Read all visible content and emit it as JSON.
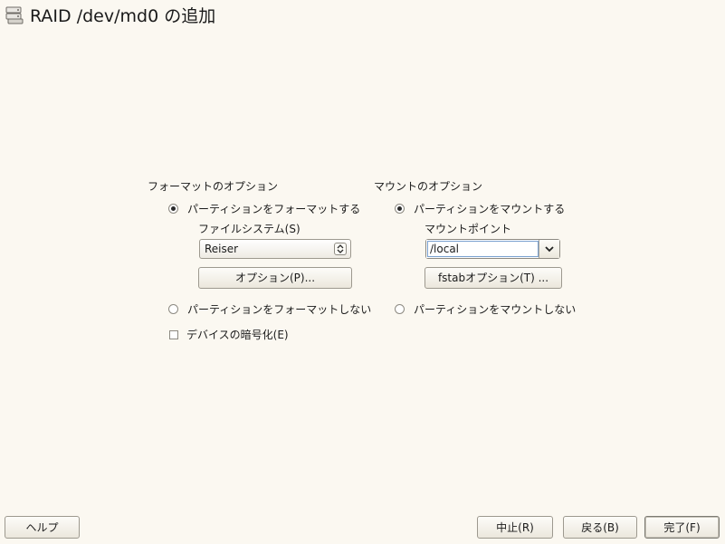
{
  "window": {
    "title": "RAID /dev/md0 の追加"
  },
  "format_options": {
    "heading": "フォーマットのオプション",
    "format_radio_label": "パーティションをフォーマットする",
    "format_selected": true,
    "filesystem_label": "ファイルシステム(S)",
    "filesystem_value": "Reiser",
    "options_button": "オプション(P)...",
    "no_format_radio_label": "パーティションをフォーマットしない",
    "encrypt_checkbox_label": "デバイスの暗号化(E)",
    "encrypt_checked": false
  },
  "mount_options": {
    "heading": "マウントのオプション",
    "mount_radio_label": "パーティションをマウントする",
    "mount_selected": true,
    "mount_point_label": "マウントポイント",
    "mount_point_value": "/local",
    "fstab_button": "fstabオプション(T) ...",
    "no_mount_radio_label": "パーティションをマウントしない"
  },
  "footer": {
    "help_button": "ヘルプ",
    "abort_button": "中止(R)",
    "back_button": "戻る(B)",
    "finish_button": "完了(F)"
  },
  "icons": {
    "title_icon": "hard-disk-icon",
    "updown_icon": "updown-arrows-icon",
    "dropdown_icon": "chevron-down-icon"
  }
}
